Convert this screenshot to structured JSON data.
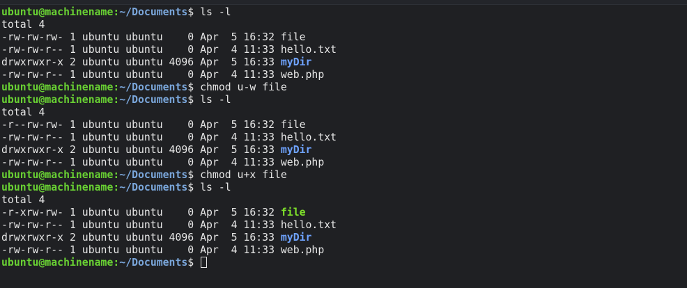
{
  "lines": [
    {
      "type": "prompt",
      "user": "ubuntu@machinename",
      "path": "~/Documents",
      "symbol": "$",
      "cmd": " ls -l"
    },
    {
      "type": "text",
      "text": "total 4"
    },
    {
      "type": "entry",
      "meta": "-rw-rw-rw- 1 ubuntu ubuntu    0 Apr  5 16:32 ",
      "name": "file",
      "kind": "file"
    },
    {
      "type": "entry",
      "meta": "-rw-rw-r-- 1 ubuntu ubuntu    0 Apr  4 11:33 ",
      "name": "hello.txt",
      "kind": "file"
    },
    {
      "type": "entry",
      "meta": "drwxrwxr-x 2 ubuntu ubuntu 4096 Apr  5 16:33 ",
      "name": "myDir",
      "kind": "dir"
    },
    {
      "type": "entry",
      "meta": "-rw-rw-r-- 1 ubuntu ubuntu    0 Apr  4 11:33 ",
      "name": "web.php",
      "kind": "file"
    },
    {
      "type": "prompt",
      "user": "ubuntu@machinename",
      "path": "~/Documents",
      "symbol": "$",
      "cmd": " chmod u-w file"
    },
    {
      "type": "prompt",
      "user": "ubuntu@machinename",
      "path": "~/Documents",
      "symbol": "$",
      "cmd": " ls -l"
    },
    {
      "type": "text",
      "text": "total 4"
    },
    {
      "type": "entry",
      "meta": "-r--rw-rw- 1 ubuntu ubuntu    0 Apr  5 16:32 ",
      "name": "file",
      "kind": "file"
    },
    {
      "type": "entry",
      "meta": "-rw-rw-r-- 1 ubuntu ubuntu    0 Apr  4 11:33 ",
      "name": "hello.txt",
      "kind": "file"
    },
    {
      "type": "entry",
      "meta": "drwxrwxr-x 2 ubuntu ubuntu 4096 Apr  5 16:33 ",
      "name": "myDir",
      "kind": "dir"
    },
    {
      "type": "entry",
      "meta": "-rw-rw-r-- 1 ubuntu ubuntu    0 Apr  4 11:33 ",
      "name": "web.php",
      "kind": "file"
    },
    {
      "type": "prompt",
      "user": "ubuntu@machinename",
      "path": "~/Documents",
      "symbol": "$",
      "cmd": " chmod u+x file"
    },
    {
      "type": "prompt",
      "user": "ubuntu@machinename",
      "path": "~/Documents",
      "symbol": "$",
      "cmd": " ls -l"
    },
    {
      "type": "text",
      "text": "total 4"
    },
    {
      "type": "entry",
      "meta": "-r-xrw-rw- 1 ubuntu ubuntu    0 Apr  5 16:32 ",
      "name": "file",
      "kind": "exe"
    },
    {
      "type": "entry",
      "meta": "-rw-rw-r-- 1 ubuntu ubuntu    0 Apr  4 11:33 ",
      "name": "hello.txt",
      "kind": "file"
    },
    {
      "type": "entry",
      "meta": "drwxrwxr-x 2 ubuntu ubuntu 4096 Apr  5 16:33 ",
      "name": "myDir",
      "kind": "dir"
    },
    {
      "type": "entry",
      "meta": "-rw-rw-r-- 1 ubuntu ubuntu    0 Apr  4 11:33 ",
      "name": "web.php",
      "kind": "file"
    },
    {
      "type": "prompt",
      "user": "ubuntu@machinename",
      "path": "~/Documents",
      "symbol": "$",
      "cmd": " ",
      "cursor": true
    }
  ],
  "colors": {
    "background": "#1f2023",
    "text": "#e6e6e6",
    "prompt_user": "#69d133",
    "prompt_path": "#7aa6da",
    "directory": "#6fa3ff",
    "executable": "#7ee02a"
  }
}
